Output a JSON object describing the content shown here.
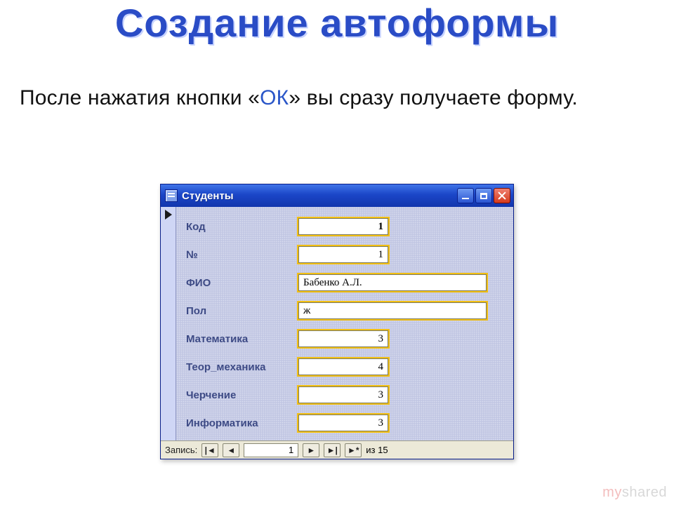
{
  "slide": {
    "headline": "Создание автоформы",
    "description_pre": "После нажатия кнопки «",
    "description_ok": "ОК",
    "description_post": "» вы сразу получаете форму."
  },
  "window": {
    "title": "Студенты",
    "fields": [
      {
        "label": "Код",
        "value": "1",
        "type": "num",
        "first": true
      },
      {
        "label": "№",
        "value": "1",
        "type": "num"
      },
      {
        "label": "ФИО",
        "value": "Бабенко А.Л.",
        "type": "txt"
      },
      {
        "label": "Пол",
        "value": "ж",
        "type": "txt"
      },
      {
        "label": "Математика",
        "value": "3",
        "type": "num"
      },
      {
        "label": "Теор_механика",
        "value": "4",
        "type": "num"
      },
      {
        "label": "Черчение",
        "value": "3",
        "type": "num"
      },
      {
        "label": "Информатика",
        "value": "3",
        "type": "num"
      }
    ]
  },
  "nav": {
    "label": "Запись:",
    "current": "1",
    "of_text": "из 15",
    "first": "|◄",
    "prev": "◄",
    "next": "►",
    "last": "►|",
    "new": "►*"
  },
  "watermark": {
    "my": "my",
    "shared": "shared"
  }
}
